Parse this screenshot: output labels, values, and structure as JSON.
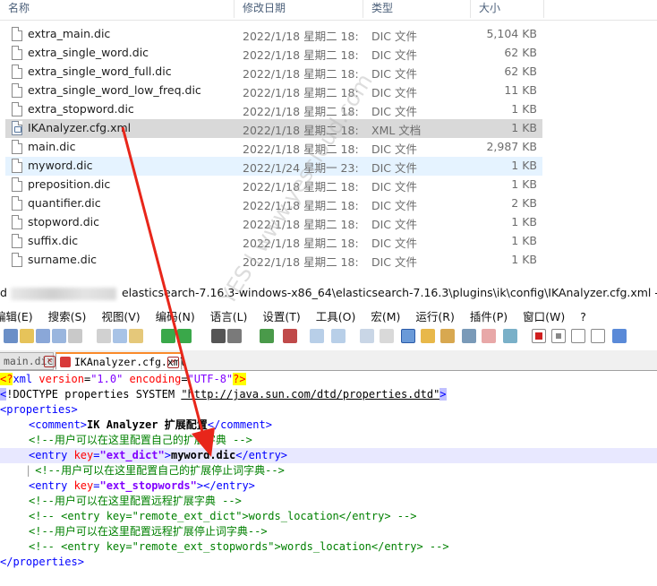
{
  "explorer": {
    "columns": {
      "name": "名称",
      "modified": "修改日期",
      "type": "类型",
      "size": "大小"
    },
    "files": [
      {
        "name": "extra_main.dic",
        "date": "2022/1/18 星期二 18:...",
        "type": "DIC 文件",
        "size": "5,104 KB",
        "icon": "file-icon"
      },
      {
        "name": "extra_single_word.dic",
        "date": "2022/1/18 星期二 18:...",
        "type": "DIC 文件",
        "size": "62 KB",
        "icon": "file-icon"
      },
      {
        "name": "extra_single_word_full.dic",
        "date": "2022/1/18 星期二 18:...",
        "type": "DIC 文件",
        "size": "62 KB",
        "icon": "file-icon"
      },
      {
        "name": "extra_single_word_low_freq.dic",
        "date": "2022/1/18 星期二 18:...",
        "type": "DIC 文件",
        "size": "11 KB",
        "icon": "file-icon"
      },
      {
        "name": "extra_stopword.dic",
        "date": "2022/1/18 星期二 18:...",
        "type": "DIC 文件",
        "size": "1 KB",
        "icon": "file-icon"
      },
      {
        "name": "IKAnalyzer.cfg.xml",
        "date": "2022/1/18 星期二 18:...",
        "type": "XML 文档",
        "size": "1 KB",
        "icon": "xml-file-icon",
        "state": "selected"
      },
      {
        "name": "main.dic",
        "date": "2022/1/18 星期二 18:...",
        "type": "DIC 文件",
        "size": "2,987 KB",
        "icon": "file-icon"
      },
      {
        "name": "myword.dic",
        "date": "2022/1/24 星期一 23:...",
        "type": "DIC 文件",
        "size": "1 KB",
        "icon": "file-icon",
        "state": "hover"
      },
      {
        "name": "preposition.dic",
        "date": "2022/1/18 星期二 18:...",
        "type": "DIC 文件",
        "size": "1 KB",
        "icon": "file-icon"
      },
      {
        "name": "quantifier.dic",
        "date": "2022/1/18 星期二 18:...",
        "type": "DIC 文件",
        "size": "2 KB",
        "icon": "file-icon"
      },
      {
        "name": "stopword.dic",
        "date": "2022/1/18 星期二 18:...",
        "type": "DIC 文件",
        "size": "1 KB",
        "icon": "file-icon"
      },
      {
        "name": "suffix.dic",
        "date": "2022/1/18 星期二 18:...",
        "type": "DIC 文件",
        "size": "1 KB",
        "icon": "file-icon"
      },
      {
        "name": "surname.dic",
        "date": "2022/1/18 星期二 18:...",
        "type": "DIC 文件",
        "size": "1 KB",
        "icon": "file-icon"
      }
    ]
  },
  "notepad": {
    "title": "elasticsearch-7.16.3-windows-x86_64\\elasticsearch-7.16.3\\plugins\\ik\\config\\IKAnalyzer.cfg.xml - Notepad++",
    "title_prefix": "d",
    "menu": [
      "编辑(E)",
      "搜索(S)",
      "视图(V)",
      "编码(N)",
      "语言(L)",
      "设置(T)",
      "工具(O)",
      "宏(M)",
      "运行(R)",
      "插件(P)",
      "窗口(W)",
      "?"
    ],
    "tabs": [
      {
        "label": "main.dic",
        "state": "inactive"
      },
      {
        "label": "IKAnalyzer.cfg.xml",
        "state": "active"
      }
    ],
    "code": {
      "l1": {
        "pi_open": "<?",
        "pi_name": "xml",
        "a1": "version",
        "v1": "\"1.0\"",
        "a2": "encoding",
        "v2": "\"UTF-8\"",
        "pi_close": "?>"
      },
      "l2": {
        "open": "<",
        "doctype": "!DOCTYPE properties SYSTEM ",
        "url": "\"http://java.sun.com/dtd/properties.dtd\"",
        "close": ">"
      },
      "l3": {
        "tag": "<properties>"
      },
      "l4": {
        "open": "<comment>",
        "text": "IK Analyzer 扩展配置",
        "close": "</comment>"
      },
      "l5": {
        "comment": "<!--用户可以在这里配置自己的扩展字典 -->"
      },
      "l6": {
        "open": "<entry ",
        "attr": "key",
        "eq": "=",
        "val": "\"ext_dict\"",
        "gt": ">",
        "text": "myword.dic",
        "close": "</entry>"
      },
      "l7": {
        "comment": "<!--用户可以在这里配置自己的扩展停止词字典-->"
      },
      "l8": {
        "open": "<entry ",
        "attr": "key",
        "eq": "=",
        "val": "\"ext_stopwords\"",
        "gt": ">",
        "close": "</entry>"
      },
      "l9": {
        "comment": "<!--用户可以在这里配置远程扩展字典 -->"
      },
      "l10": {
        "comment": "<!-- <entry key=\"remote_ext_dict\">words_location</entry> -->"
      },
      "l11": {
        "comment": "<!--用户可以在这里配置远程扩展停止词字典-->"
      },
      "l12": {
        "comment": "<!-- <entry key=\"remote_ext_stopwords\">words_location</entry> -->"
      },
      "l13": {
        "tag": "</properties>"
      }
    }
  },
  "watermark": "YES | www.yescloud.com",
  "colors": {
    "arrow": "#e8261a",
    "selected_row": "#d9d9d9",
    "hover_row": "#e5f3ff",
    "tag": "#0000ff",
    "attr": "#ff0000",
    "comment": "#008000"
  }
}
